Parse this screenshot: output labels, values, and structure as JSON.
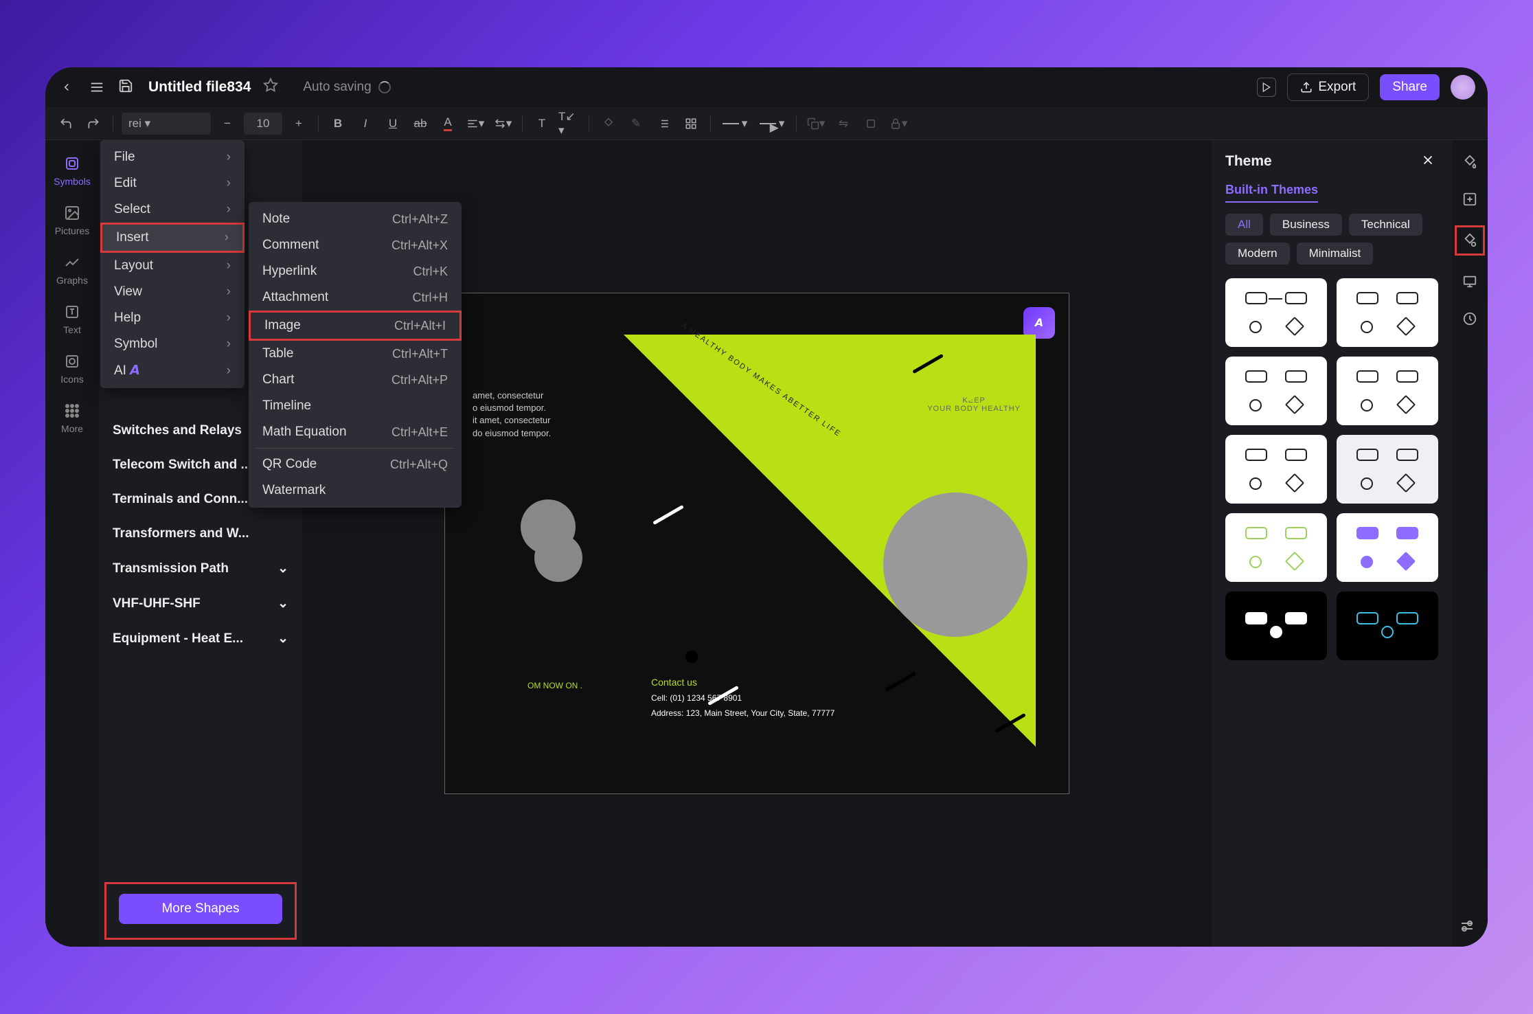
{
  "header": {
    "title": "Untitled file834",
    "autosave_label": "Auto saving",
    "export_label": "Export",
    "share_label": "Share"
  },
  "toolbar": {
    "font_size": "10"
  },
  "leftbar": {
    "items": [
      {
        "label": "Symbols"
      },
      {
        "label": "Pictures"
      },
      {
        "label": "Graphs"
      },
      {
        "label": "Text"
      },
      {
        "label": "Icons"
      },
      {
        "label": "More"
      }
    ]
  },
  "shapes_panel": {
    "categories": [
      "Switches and Relays",
      "Telecom Switch and ...",
      "Terminals and Conn...",
      "Transformers and W...",
      "Transmission Path",
      "VHF-UHF-SHF",
      "Equipment - Heat E..."
    ],
    "more_label": "More Shapes"
  },
  "menu_main": [
    {
      "label": "File",
      "arrow": true
    },
    {
      "label": "Edit",
      "arrow": true
    },
    {
      "label": "Select",
      "arrow": true
    },
    {
      "label": "Insert",
      "arrow": true,
      "hl": true
    },
    {
      "label": "Layout",
      "arrow": true
    },
    {
      "label": "View",
      "arrow": true
    },
    {
      "label": "Help",
      "arrow": true
    },
    {
      "label": "Symbol",
      "arrow": true
    },
    {
      "label": "AI",
      "arrow": true,
      "ai": true
    }
  ],
  "menu_insert": [
    {
      "label": "Note",
      "shortcut": "Ctrl+Alt+Z"
    },
    {
      "label": "Comment",
      "shortcut": "Ctrl+Alt+X"
    },
    {
      "label": "Hyperlink",
      "shortcut": "Ctrl+K"
    },
    {
      "label": "Attachment",
      "shortcut": "Ctrl+H"
    },
    {
      "label": "Image",
      "shortcut": "Ctrl+Alt+I",
      "hl": true
    },
    {
      "label": "Table",
      "shortcut": "Ctrl+Alt+T"
    },
    {
      "label": "Chart",
      "shortcut": "Ctrl+Alt+P"
    },
    {
      "label": "Timeline",
      "shortcut": ""
    },
    {
      "label": "Math Equation",
      "shortcut": "Ctrl+Alt+E"
    },
    {
      "label": "QR Code",
      "shortcut": "Ctrl+Alt+Q"
    },
    {
      "label": "Watermark",
      "shortcut": ""
    }
  ],
  "canvas": {
    "lorem1": "amet, consectetur",
    "lorem2": "o eiusmod tempor.",
    "lorem3": "it amet, consectetur",
    "lorem4": "do eiusmod tempor.",
    "keep": "KEEP",
    "keep2": "YOUR BODY HEALTHY",
    "arc": "A HEALTHY BODY MAKES ABETTER LIFE",
    "tag": "OM NOW ON .",
    "contact_title": "Contact us",
    "cell": "Cell: (01) 1234 567 8901",
    "address": "Address: 123, Main Street, Your City, State, 77777"
  },
  "theme_panel": {
    "title": "Theme",
    "subtitle": "Built-in Themes",
    "pills": [
      "All",
      "Business",
      "Technical",
      "Modern",
      "Minimalist"
    ]
  },
  "colors": {
    "accent": "#7a4dff",
    "highlight_red": "#d63a3a",
    "lime": "#b8e015"
  }
}
